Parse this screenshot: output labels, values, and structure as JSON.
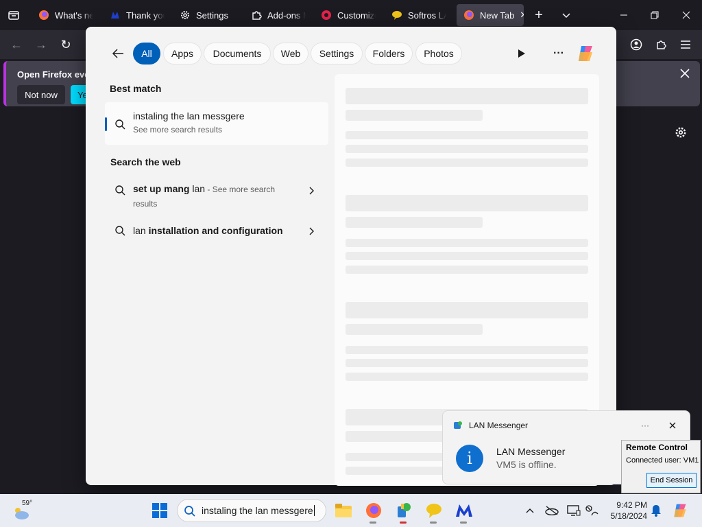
{
  "browser": {
    "tabs": [
      {
        "label": "What's new",
        "icon": "firefox-icon"
      },
      {
        "label": "Thank you",
        "icon": "malwarebytes-icon"
      },
      {
        "label": "Settings",
        "icon": "gear-icon"
      },
      {
        "label": "Add-ons Manager",
        "icon": "puzzle-icon"
      },
      {
        "label": "Customize",
        "icon": "firefox-icon"
      },
      {
        "label": "Softros LAN",
        "icon": "chat-bubble-icon"
      },
      {
        "label": "New Tab",
        "icon": "firefox-icon"
      }
    ],
    "notification": {
      "text": "Open Firefox every",
      "not_now": "Not now",
      "yes": "Ye"
    }
  },
  "start_menu": {
    "filters": [
      "All",
      "Apps",
      "Documents",
      "Web",
      "Settings",
      "Folders",
      "Photos"
    ],
    "best_match_heading": "Best match",
    "best_match": {
      "title": "instaling the lan messgere",
      "subtitle": "See more search results"
    },
    "web_heading": "Search the web",
    "web_results": [
      {
        "bold": "set up mang",
        "normal": " lan",
        "suffix": " - See more search",
        "suffix2": "results"
      },
      {
        "normal": "lan ",
        "bold": "installation and configuration"
      }
    ]
  },
  "toast": {
    "app": "LAN Messenger",
    "title": "LAN Messenger",
    "message": "VM5 is offline."
  },
  "remote_control": {
    "title": "Remote Control",
    "connected": "Connected user: VM1",
    "button": "End Session"
  },
  "taskbar": {
    "weather": "59°",
    "search_value": "instaling the lan messgere",
    "time": "9:42 PM",
    "date": "5/18/2024"
  },
  "colors": {
    "accent": "#005fb8",
    "firefox_bg": "#1c1b22",
    "notif_accent": "#b833e1"
  }
}
